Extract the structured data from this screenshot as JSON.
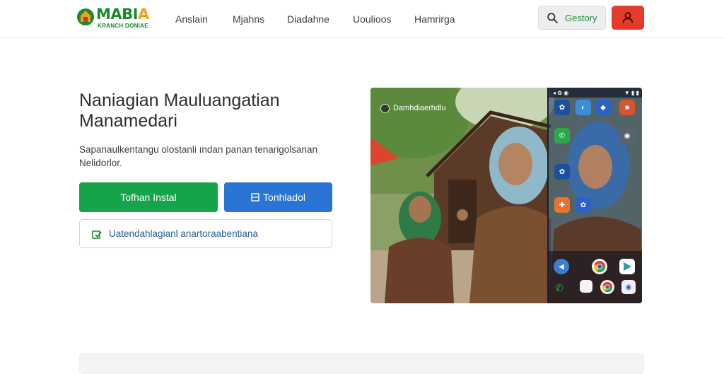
{
  "brand": {
    "name_main": "MABI",
    "name_accent": "A",
    "tagline": "KRANCH DONIAE",
    "color_primary": "#1a8a2e",
    "color_accent": "#f0a21c"
  },
  "nav": {
    "items": [
      {
        "label": "Anslain"
      },
      {
        "label": "Mjahns"
      },
      {
        "label": "Diadahne"
      },
      {
        "label": "Uoulioos"
      },
      {
        "label": "Hamrirga"
      }
    ]
  },
  "header_actions": {
    "search_label": "Gestory",
    "search_icon": "search-icon",
    "user_icon": "user-icon",
    "user_button_color": "#e53b2c"
  },
  "hero": {
    "title_line1": "Naniagian Mauluangatian",
    "title_line2": "Manamedari",
    "desc_line1": "Sapanaulkentangu olostanli ından panan tenarigolsanan",
    "desc_line2": "Nelidorlor.",
    "primary_button": "Tofhan Instal",
    "primary_color": "#16a34a",
    "secondary_button": "Tonhladol",
    "secondary_color": "#2a74d4",
    "outline_button": "Uatendahlagianl anartoraabentiana",
    "image_caption": "Damhdiaerhdlu"
  },
  "phone": {
    "status_left": "◂ ✿ ◉",
    "status_right": "▼ ▮ ▮"
  }
}
